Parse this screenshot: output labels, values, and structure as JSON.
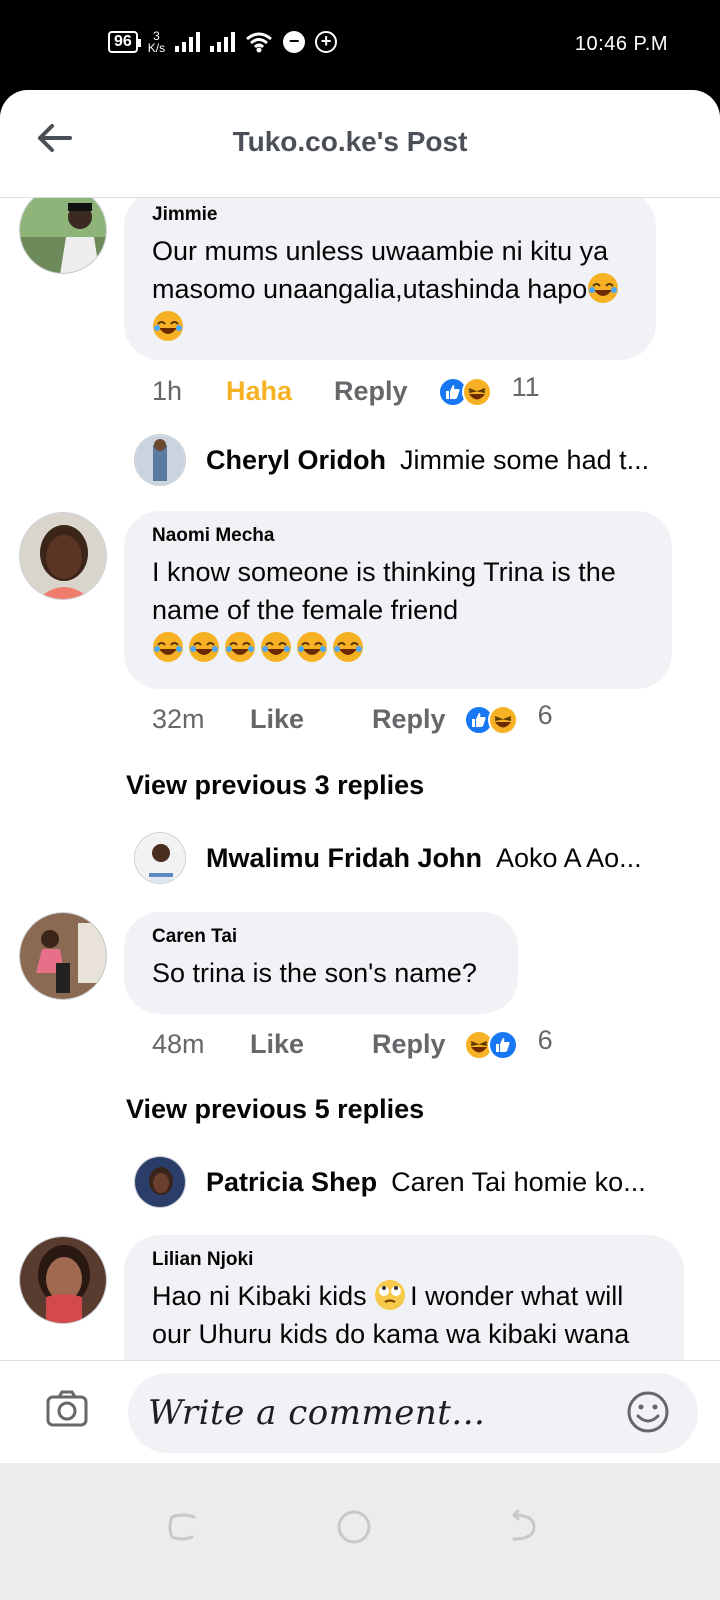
{
  "status_bar": {
    "battery": "96",
    "net_speed_value": "3",
    "net_speed_unit": "K/s",
    "time": "10:46 P.M"
  },
  "header": {
    "title": "Tuko.co.ke's Post"
  },
  "comments": [
    {
      "name": "Jimmie",
      "text": "Our mums unless uwaambie ni kitu ya masomo unaangalia,utashinda hapo",
      "time": "1h",
      "reaction_label": "Haha",
      "reply_label": "Reply",
      "reaction_count": "11",
      "reply_preview": {
        "name": "Cheryl Oridoh",
        "text": "Jimmie some had t..."
      }
    },
    {
      "name": "Naomi Mecha",
      "text": "I know someone is thinking Trina is the name of the female friend",
      "time": "32m",
      "reaction_label": "Like",
      "reply_label": "Reply",
      "reaction_count": "6",
      "view_previous": "View previous 3 replies",
      "reply_preview": {
        "name": "Mwalimu Fridah John",
        "text": "Aoko A Ao..."
      }
    },
    {
      "name": "Caren Tai",
      "text": "So trina is the son's name?",
      "time": "48m",
      "reaction_label": "Like",
      "reply_label": "Reply",
      "reaction_count": "6",
      "view_previous": "View previous 5 replies",
      "reply_preview": {
        "name": "Patricia Shep",
        "text": "Caren Tai homie ko..."
      }
    },
    {
      "name": "Lilian Njoki",
      "text_part1": "Hao ni Kibaki kids ",
      "text_part2": "I wonder what will our Uhuru kids do kama wa kibaki wana"
    }
  ],
  "composer": {
    "placeholder": "Write a comment..."
  },
  "colors": {
    "accent_haha": "#f7b125",
    "like_blue": "#1877f2",
    "bubble_bg": "#f0f2f5",
    "meta_text": "#65676b"
  },
  "icons": [
    "back-arrow-icon",
    "camera-icon",
    "smiley-icon",
    "like-reaction-icon",
    "haha-reaction-icon",
    "laughing-emoji-icon",
    "rolling-eyes-emoji-icon"
  ]
}
